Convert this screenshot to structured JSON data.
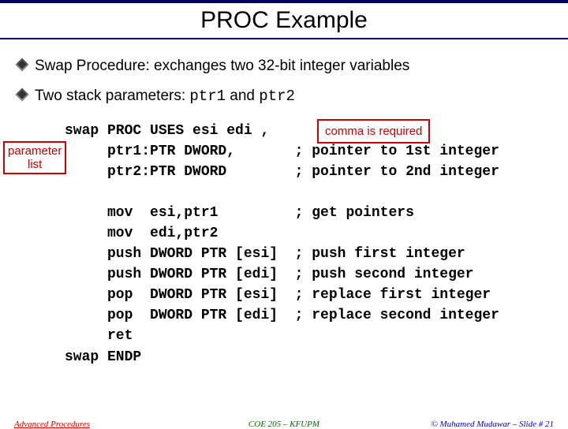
{
  "title": "PROC Example",
  "bullets": [
    {
      "pre": "Swap Procedure: exchanges two 32-bit integer variables"
    },
    {
      "pre": "Two stack parameters: ",
      "c1": "ptr1",
      "mid": " and ",
      "c2": "ptr2"
    }
  ],
  "callouts": {
    "param_l1": "parameter",
    "param_l2": "list",
    "comma": "comma is required"
  },
  "code": "swap PROC USES esi edi ,\n     ptr1:PTR DWORD,       ; pointer to 1st integer\n     ptr2:PTR DWORD        ; pointer to 2nd integer\n\n     mov  esi,ptr1         ; get pointers\n     mov  edi,ptr2\n     push DWORD PTR [esi]  ; push first integer\n     push DWORD PTR [edi]  ; push second integer\n     pop  DWORD PTR [esi]  ; replace first integer\n     pop  DWORD PTR [edi]  ; replace second integer\n     ret\nswap ENDP",
  "footer": {
    "left": "Advanced Procedures",
    "center": "COE 205 – KFUPM",
    "right": "© Muhamed Mudawar – Slide # 21"
  }
}
